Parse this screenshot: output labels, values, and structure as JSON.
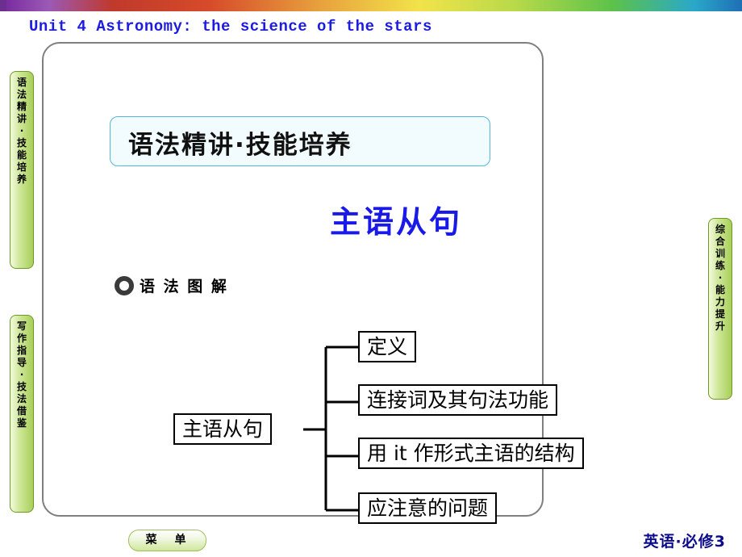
{
  "header": {
    "title": "Unit 4  Astronomy: the science of the stars"
  },
  "section": {
    "heading": "语法精讲·技能培养",
    "blue_title": "主语从句",
    "sub_label": "语 法 图 解",
    "bullet_icon": "ring-bullet-icon"
  },
  "side_tabs": {
    "left": [
      {
        "name": "tab-grammar-skill",
        "text": "语法精讲·技能培养"
      },
      {
        "name": "tab-writing-guide",
        "text": "写作指导·技法借鉴"
      }
    ],
    "right": [
      {
        "name": "tab-comprehensive-training",
        "text": "综合训练·能力提升"
      }
    ]
  },
  "diagram": {
    "type": "tree",
    "root": "主语从句",
    "branches": [
      "定义",
      "连接词及其句法功能",
      "用 it 作形式主语的结构",
      "应注意的问题"
    ]
  },
  "footer": {
    "menu_button": "菜　单",
    "right_label": "英语·必修3"
  },
  "colors": {
    "title_blue": "#1c1ce0",
    "heading_border": "#53b6d8",
    "tab_green": "#a8cf5a",
    "footer_navy": "#0c0c8c"
  }
}
